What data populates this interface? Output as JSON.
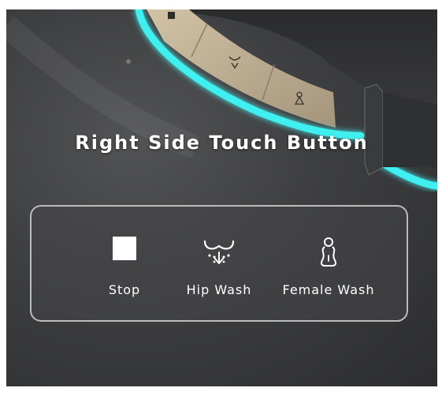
{
  "heading": "Right Side Touch Button",
  "buttons": [
    {
      "label": "Stop",
      "icon": "stop-square-icon"
    },
    {
      "label": "Hip Wash",
      "icon": "hip-wash-icon"
    },
    {
      "label": "Female Wash",
      "icon": "female-wash-icon"
    }
  ],
  "colors": {
    "glow": "#3ff0f0",
    "panel_trim": "#c4b49a",
    "background": "#3d3e40"
  }
}
